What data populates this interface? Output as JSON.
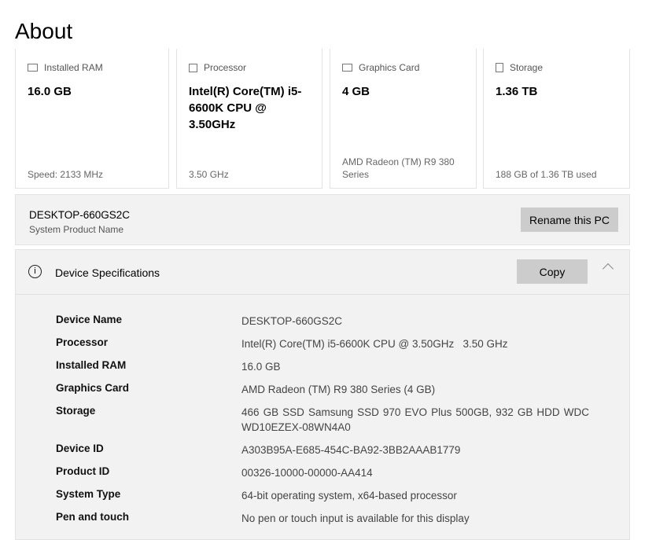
{
  "title": "About",
  "cards": [
    {
      "icon": "memory-icon",
      "label": "Installed RAM",
      "value": "16.0 GB",
      "sub": "Speed: 2133 MHz"
    },
    {
      "icon": "processor-icon",
      "label": "Processor",
      "value": "Intel(R) Core(TM) i5-6600K CPU @ 3.50GHz",
      "sub": "3.50 GHz"
    },
    {
      "icon": "graphics-card-icon",
      "label": "Graphics Card",
      "value": "4 GB",
      "sub": "AMD Radeon (TM) R9 380 Series"
    },
    {
      "icon": "storage-icon",
      "label": "Storage",
      "value": "1.36 TB",
      "sub": "188 GB of 1.36 TB used"
    }
  ],
  "pc": {
    "name": "DESKTOP-660GS2C",
    "caption": "System Product Name",
    "rename": "Rename this PC"
  },
  "specs": {
    "title": "Device Specifications",
    "copy": "Copy",
    "rows": [
      {
        "label": "Device Name",
        "value": "DESKTOP-660GS2C"
      },
      {
        "label": "Processor",
        "value": "Intel(R) Core(TM) i5-6600K CPU @ 3.50GHz   3.50 GHz"
      },
      {
        "label": "Installed RAM",
        "value": "16.0 GB"
      },
      {
        "label": "Graphics Card",
        "value": "AMD Radeon (TM) R9 380 Series (4 GB)"
      },
      {
        "label": "Storage",
        "value": "466 GB SSD Samsung SSD 970 EVO Plus 500GB, 932 GB HDD WDC WD10EZEX-08WN4A0"
      },
      {
        "label": "Device ID",
        "value": "A303B95A-E685-454C-BA92-3BB2AAAB1779"
      },
      {
        "label": "Product ID",
        "value": "00326-10000-00000-AA414"
      },
      {
        "label": "System Type",
        "value": "64-bit operating system, x64-based processor"
      },
      {
        "label": "Pen and touch",
        "value": "No pen or touch input is available for this display"
      }
    ]
  }
}
